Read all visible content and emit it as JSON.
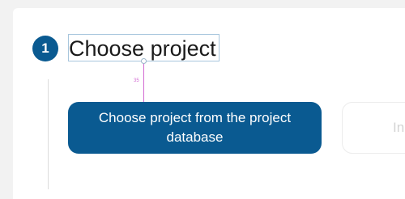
{
  "step": {
    "number": "1",
    "title": "Choose project"
  },
  "measurement": {
    "spacing_label": "35"
  },
  "actions": {
    "primary_label": "Choose project from the project database",
    "secondary_label_partial": "In"
  },
  "colors": {
    "accent": "#0a5a91",
    "measure_guide": "#d36bd3",
    "title_outline": "#a8c6dd"
  }
}
